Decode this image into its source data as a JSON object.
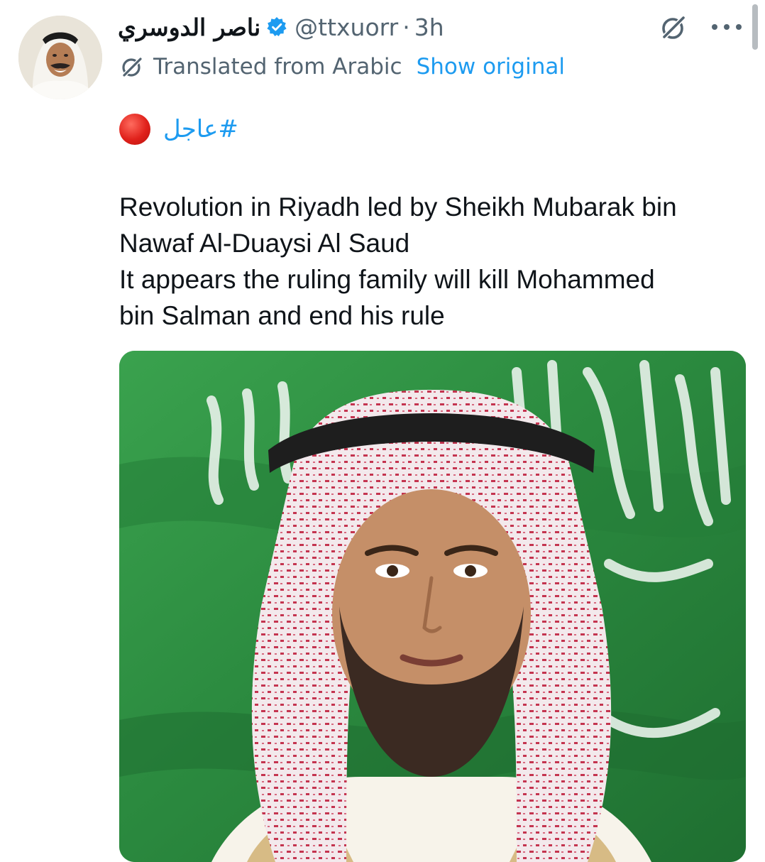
{
  "post": {
    "author": {
      "display_name": "ناصر الدوسري",
      "handle": "@ttxuorr",
      "separator": "·",
      "timestamp": "3h",
      "verified": true
    },
    "translation": {
      "label": "Translated from Arabic",
      "show_original": "Show original"
    },
    "hashtag_line": {
      "emoji": "red-circle",
      "hashtag": "#عاجل"
    },
    "text_lines": [
      "Revolution in Riyadh led by Sheikh Mubarak bin\nNawaf Al-Duaysi Al Saud",
      "It appears the ruling family will kill Mohammed\nbin Salman and end his rule"
    ],
    "media": {
      "type": "photo",
      "description_icon": "portrait-photo"
    }
  },
  "icons": {
    "verified": "verified-badge-icon",
    "grok": "grok-icon",
    "more": "more-options-icon",
    "translate": "translate-icon"
  },
  "colors": {
    "text_primary": "#0f1419",
    "text_secondary": "#536471",
    "link": "#1d9bf0",
    "flag_green": "#2d8a3e"
  }
}
